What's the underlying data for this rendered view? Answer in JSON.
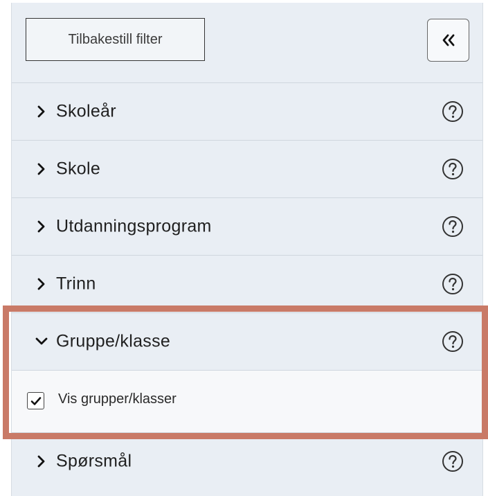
{
  "toolbar": {
    "reset_label": "Tilbakestill filter",
    "collapse_icon": "double-chevron-left-icon"
  },
  "sections": [
    {
      "label": "Skoleår",
      "expanded": false
    },
    {
      "label": "Skole",
      "expanded": false
    },
    {
      "label": "Utdanningsprogram",
      "expanded": false
    },
    {
      "label": "Trinn",
      "expanded": false
    },
    {
      "label": "Gruppe/klasse",
      "expanded": true
    },
    {
      "label": "Spørsmål",
      "expanded": false
    }
  ],
  "group_options": {
    "show_groups_label": "Vis grupper/klasser",
    "show_groups_checked": true
  },
  "colors": {
    "panel_background": "#e9eef4",
    "expanded_background": "#f7f8fa",
    "highlight_border": "#c97a67"
  }
}
